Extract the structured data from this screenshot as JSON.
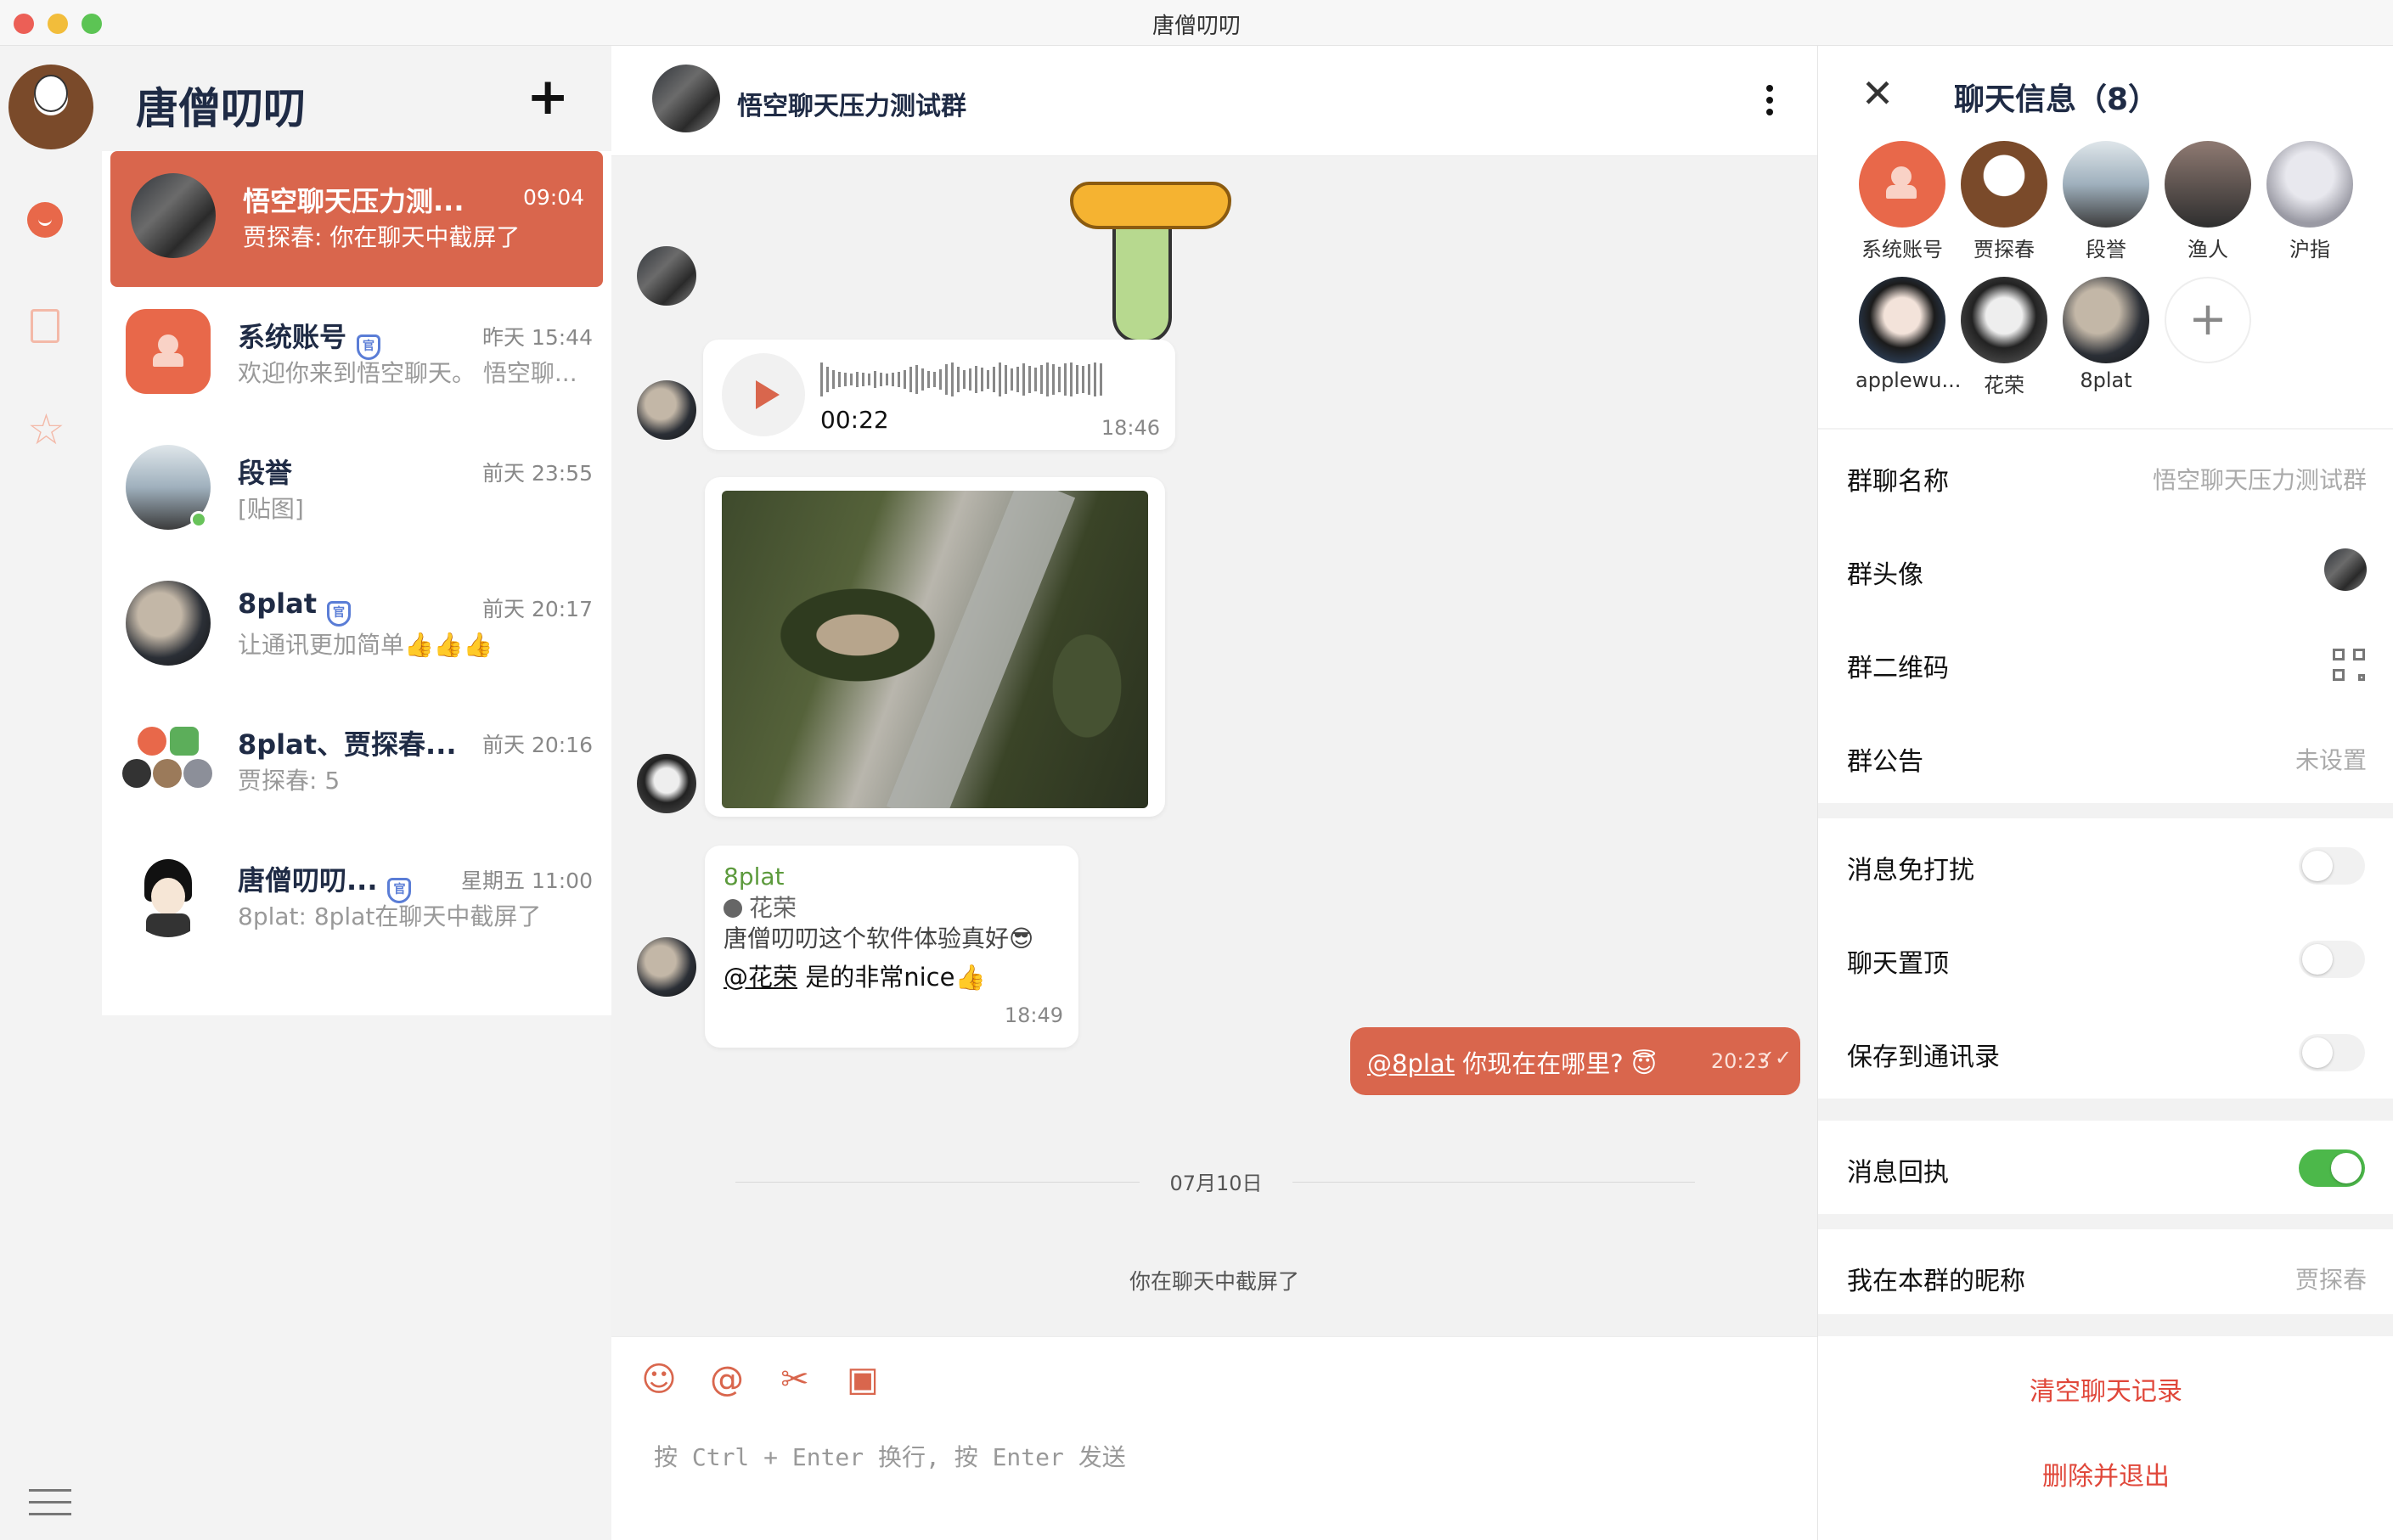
{
  "window": {
    "title": "唐僧叨叨"
  },
  "rail": {
    "menu_icon": "hamburger-icon"
  },
  "conversations": {
    "header": "唐僧叨叨",
    "add_label": "+",
    "items": [
      {
        "name": "悟空聊天压力测...",
        "time": "09:04",
        "preview": "贾探春: 你在聊天中截屏了"
      },
      {
        "name": "系统账号",
        "time": "昨天 15:44",
        "preview": "欢迎你来到悟空聊天。 悟空聊..."
      },
      {
        "name": "段誉",
        "time": "前天 23:55",
        "preview": "[贴图]"
      },
      {
        "name": "8plat",
        "time": "前天 20:17",
        "preview": "让通讯更加简单👍👍👍"
      },
      {
        "name": "8plat、贾探春...",
        "time": "前天 20:16",
        "preview": "贾探春: 5"
      },
      {
        "name": "唐僧叨叨...",
        "time": "星期五 11:00",
        "preview": "8plat: 8plat在聊天中截屏了"
      }
    ],
    "verified_mark": "官"
  },
  "chat": {
    "title": "悟空聊天压力测试群",
    "voice": {
      "duration": "00:22",
      "time": "18:46"
    },
    "text_message": {
      "sender": "8plat",
      "quote_name": "花荣",
      "line1": "唐僧叨叨这个软件体验真好😎",
      "mention": "@花荣",
      "rest": " 是的非常nice👍",
      "time": "18:49"
    },
    "my_message": {
      "mention": "@8plat",
      "rest": " 你现在在哪里? 😇",
      "time": "20:23",
      "ticks": "✓✓"
    },
    "date_separator": "07月10日",
    "system_note": "你在聊天中截屏了",
    "composer": {
      "placeholder": "按 Ctrl + Enter 换行, 按 Enter 发送",
      "tools": [
        "emoji-icon",
        "mention-icon",
        "scissors-icon",
        "image-icon"
      ],
      "tool_glyphs": [
        "☺",
        "@",
        "✂",
        "▣"
      ]
    }
  },
  "info": {
    "title": "聊天信息（8）",
    "close": "✕",
    "members": [
      "系统账号",
      "贾探春",
      "段誉",
      "渔人",
      "沪指",
      "applewu...",
      "花荣",
      "8plat"
    ],
    "add_member": "+",
    "group_name_label": "群聊名称",
    "group_name_value": "悟空聊天压力测试群",
    "group_avatar_label": "群头像",
    "group_qr_label": "群二维码",
    "announcement_label": "群公告",
    "announcement_value": "未设置",
    "mute_label": "消息免打扰",
    "pin_label": "聊天置顶",
    "save_label": "保存到通讯录",
    "receipt_label": "消息回执",
    "nickname_label": "我在本群的昵称",
    "nickname_value": "贾探春",
    "clear_label": "清空聊天记录",
    "exit_label": "删除并退出",
    "toggles": {
      "mute": false,
      "pin": false,
      "save": false,
      "receipt": true
    }
  }
}
